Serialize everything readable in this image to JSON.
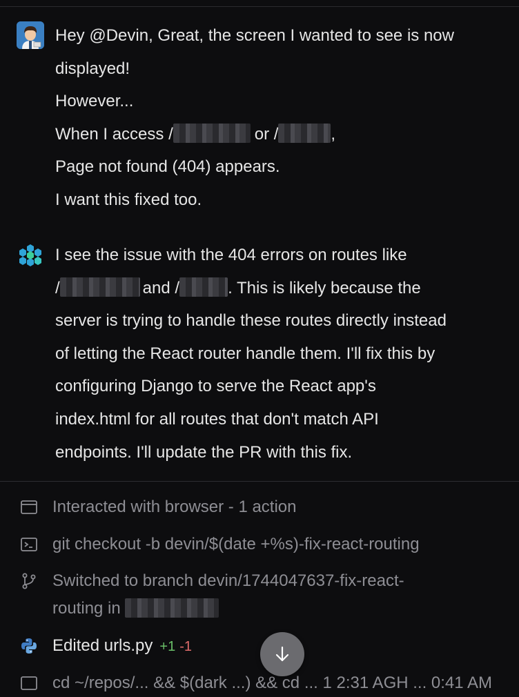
{
  "user_message": {
    "lines": [
      "Hey @Devin, Great, the screen I wanted to see is now",
      "displayed!",
      "However...",
      "When I access /",
      "or /",
      ",",
      "Page not found (404) appears.",
      "I want this fixed too."
    ]
  },
  "devin_message": {
    "lines": [
      "I see the issue with the 404 errors on routes like",
      "/",
      "and /",
      ". This is likely because the",
      "server is trying to handle these routes directly instead",
      "of letting the React router handle them. I'll fix this by",
      "configuring Django to serve the React app's",
      "index.html for all routes that don't match API",
      "endpoints. I'll update the PR with this fix."
    ]
  },
  "actions": [
    {
      "icon": "browser-window-icon",
      "text": "Interacted with browser - 1 action"
    },
    {
      "icon": "terminal-icon",
      "text": "git checkout -b devin/$(date +%s)-fix-react-routing"
    },
    {
      "icon": "git-branch-icon",
      "text": "Switched to branch devin/1744047637-fix-react-",
      "text2": "routing in "
    },
    {
      "icon": "python-icon",
      "text": "Edited urls.py",
      "additions": "+1",
      "deletions": "-1"
    },
    {
      "icon": "terminal-icon",
      "text": "cd ~/repos/... && $(dark ...) && cd ... 1 2:31 AGH ... 0:41 AM"
    }
  ],
  "colors": {
    "background": "#0d0d0f",
    "text": "#e6e6e6",
    "muted": "#8e8e94",
    "additions": "#6abf69",
    "deletions": "#e06c6c"
  }
}
